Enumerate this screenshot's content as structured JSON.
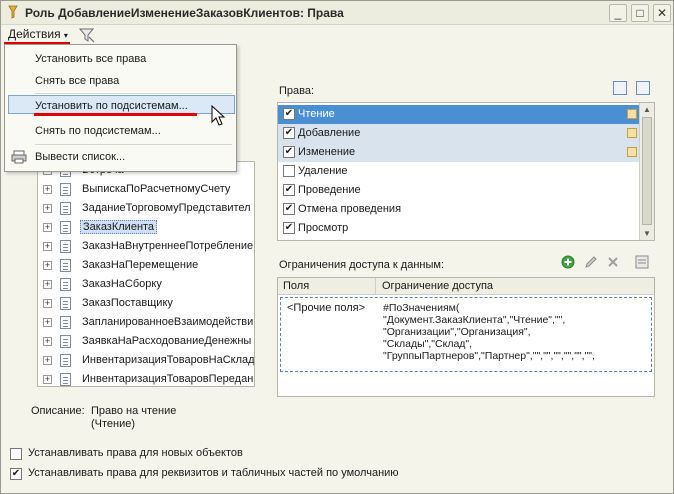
{
  "window": {
    "title": "Роль ДобавлениеИзменениеЗаказовКлиентов: Права",
    "controls": [
      "_",
      "□",
      "✕"
    ]
  },
  "toolbar": {
    "actions_label": "Действия"
  },
  "menu": {
    "items": [
      {
        "label": "Установить все права"
      },
      {
        "label": "Снять все права"
      },
      {
        "label": "Установить по подсистемам..."
      },
      {
        "label": "Снять по подсистемам..."
      },
      {
        "label": "Вывести список..."
      }
    ]
  },
  "tree": {
    "items": [
      {
        "label": "Встреча"
      },
      {
        "label": "ВыпискаПоРасчетномуСчету"
      },
      {
        "label": "ЗаданиеТорговомуПредставител"
      },
      {
        "label": "ЗаказКлиента",
        "selected": true
      },
      {
        "label": "ЗаказНаВнутреннееПотребление"
      },
      {
        "label": "ЗаказНаПеремещение"
      },
      {
        "label": "ЗаказНаСборку"
      },
      {
        "label": "ЗаказПоставщику"
      },
      {
        "label": "ЗапланированноеВзаимодействи"
      },
      {
        "label": "ЗаявкаНаРасходованиеДенежны"
      },
      {
        "label": "ИнвентаризацияТоваровНаСклад"
      },
      {
        "label": "ИнвентаризацияТоваровПередан"
      }
    ]
  },
  "description": {
    "label": "Описание:",
    "line1": "Право на чтение",
    "line2": "(Чтение)"
  },
  "rights": {
    "title": "Права:",
    "items": [
      {
        "label": "Чтение",
        "checked": "✔",
        "state": "selected"
      },
      {
        "label": "Добавление",
        "checked": "✔",
        "state": "highlight"
      },
      {
        "label": "Изменение",
        "checked": "✔",
        "state": "highlight"
      },
      {
        "label": "Удаление",
        "checked": "",
        "state": "normal"
      },
      {
        "label": "Проведение",
        "checked": "✔",
        "state": "normal"
      },
      {
        "label": "Отмена проведения",
        "checked": "✔",
        "state": "normal"
      },
      {
        "label": "Просмотр",
        "checked": "✔",
        "state": "normal"
      }
    ]
  },
  "limits": {
    "title": "Ограничения доступа к данным:",
    "columns": {
      "field": "Поля",
      "restriction": "Ограничение доступа"
    },
    "row": {
      "field": "<Прочие поля>",
      "restriction": "#ПоЗначениям(\n\"Документ.ЗаказКлиента\",\"Чтение\",\"\",\n\"Организации\",\"Организация\",\n\"Склады\",\"Склад\",\n\"ГруппыПартнеров\",\"Партнер\",\"\",\"\",\"\",\"\",\"\",\"\","
    }
  },
  "options": {
    "new_objects": {
      "label": "Устанавливать права для новых объектов",
      "checked": ""
    },
    "attributes": {
      "label": "Устанавливать права для реквизитов и табличных частей по умолчанию",
      "checked": "✔"
    }
  },
  "colors": {
    "accent": "#4a8fd1",
    "underline": "#e00000",
    "menu_highlight": "#dbe8f6"
  }
}
